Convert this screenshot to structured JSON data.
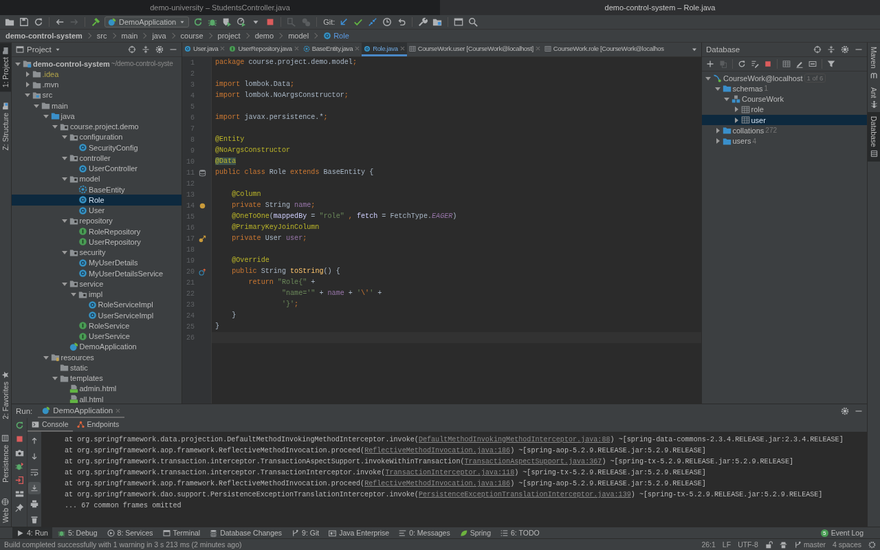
{
  "window_tabs": [
    {
      "title": "demo-university – StudentsController.java",
      "selected": false
    },
    {
      "title": "demo-control-system – Role.java",
      "selected": true
    }
  ],
  "toolbar": [
    {
      "kind": "open",
      "disabled": false
    },
    {
      "kind": "save",
      "disabled": false
    },
    {
      "kind": "sync",
      "disabled": false
    },
    {
      "kind": "sep"
    },
    {
      "kind": "back",
      "disabled": false
    },
    {
      "kind": "forward",
      "disabled": true
    },
    {
      "kind": "sep"
    },
    {
      "kind": "hammer",
      "disabled": false
    },
    {
      "kind": "config",
      "label": "DemoApplication"
    },
    {
      "kind": "rerun",
      "disabled": false
    },
    {
      "kind": "bug",
      "disabled": false
    },
    {
      "kind": "coverage",
      "disabled": false
    },
    {
      "kind": "profile",
      "disabled": false
    },
    {
      "kind": "caret",
      "disabled": false
    },
    {
      "kind": "stop",
      "disabled": false
    },
    {
      "kind": "sep"
    },
    {
      "kind": "attach",
      "disabled": true
    },
    {
      "kind": "threads",
      "disabled": true
    },
    {
      "kind": "sep"
    },
    {
      "kind": "label",
      "text": "Git:"
    },
    {
      "kind": "gitupdate",
      "disabled": false
    },
    {
      "kind": "check",
      "disabled": false
    },
    {
      "kind": "merge",
      "disabled": false
    },
    {
      "kind": "history",
      "disabled": false
    },
    {
      "kind": "revert",
      "disabled": false
    },
    {
      "kind": "sep"
    },
    {
      "kind": "wrench",
      "disabled": false
    },
    {
      "kind": "structure",
      "disabled": false
    },
    {
      "kind": "sep"
    },
    {
      "kind": "terminal",
      "disabled": false
    },
    {
      "kind": "search",
      "disabled": false
    }
  ],
  "breadcrumb": [
    {
      "label": "demo-control-system",
      "kind": "root"
    },
    {
      "label": "src",
      "kind": "plain"
    },
    {
      "label": "main",
      "kind": "plain"
    },
    {
      "label": "java",
      "kind": "plain"
    },
    {
      "label": "course",
      "kind": "plain"
    },
    {
      "label": "project",
      "kind": "plain"
    },
    {
      "label": "demo",
      "kind": "plain"
    },
    {
      "label": "model",
      "kind": "plain"
    },
    {
      "label": "Role",
      "kind": "class"
    }
  ],
  "left_stripe": {
    "top": [
      {
        "label": "1: Project",
        "kind": "folder",
        "selected": true
      },
      {
        "label": "Z: Structure",
        "kind": "structure",
        "selected": false
      }
    ],
    "bottom": [
      {
        "label": "2: Favorites",
        "kind": "star",
        "selected": false
      },
      {
        "label": "Persistence",
        "kind": "persistence",
        "selected": false
      },
      {
        "label": "Web",
        "kind": "web",
        "selected": false
      }
    ]
  },
  "right_stripe": [
    {
      "label": "Maven",
      "kind": "maven",
      "selected": false
    },
    {
      "label": "Ant",
      "kind": "ant",
      "selected": false
    },
    {
      "label": "Database",
      "kind": "database",
      "selected": true
    }
  ],
  "project": {
    "title": "Project",
    "tree": [
      {
        "label": "demo-control-system",
        "hint": "~/demo-control-syste",
        "kind": "module",
        "expanded": true,
        "selected": false,
        "ignored": false,
        "children": [
          {
            "label": ".idea",
            "kind": "folder",
            "expanded": false,
            "selected": false,
            "ignored": true
          },
          {
            "label": ".mvn",
            "kind": "folder",
            "expanded": false,
            "selected": false,
            "ignored": false
          },
          {
            "label": "src",
            "kind": "src",
            "expanded": true,
            "selected": false,
            "ignored": false,
            "children": [
              {
                "label": "main",
                "kind": "folder",
                "expanded": true,
                "selected": false,
                "ignored": false,
                "children": [
                  {
                    "label": "java",
                    "kind": "folder-blue",
                    "expanded": true,
                    "selected": false,
                    "ignored": false,
                    "children": [
                      {
                        "label": "course.project.demo",
                        "kind": "package",
                        "expanded": true,
                        "selected": false,
                        "ignored": false,
                        "children": [
                          {
                            "label": "configuration",
                            "kind": "package",
                            "expanded": true,
                            "selected": false,
                            "ignored": false,
                            "children": [
                              {
                                "label": "SecurityConfig",
                                "kind": "class",
                                "selected": false,
                                "ignored": false
                              }
                            ]
                          },
                          {
                            "label": "controller",
                            "kind": "package",
                            "expanded": true,
                            "selected": false,
                            "ignored": false,
                            "children": [
                              {
                                "label": "UserController",
                                "kind": "class",
                                "selected": false,
                                "ignored": false
                              }
                            ]
                          },
                          {
                            "label": "model",
                            "kind": "package",
                            "expanded": true,
                            "selected": false,
                            "ignored": false,
                            "children": [
                              {
                                "label": "BaseEntity",
                                "kind": "abstract",
                                "selected": false,
                                "ignored": false
                              },
                              {
                                "label": "Role",
                                "kind": "class",
                                "selected": true,
                                "ignored": false
                              },
                              {
                                "label": "User",
                                "kind": "class",
                                "selected": false,
                                "ignored": false
                              }
                            ]
                          },
                          {
                            "label": "repository",
                            "kind": "package",
                            "expanded": true,
                            "selected": false,
                            "ignored": false,
                            "children": [
                              {
                                "label": "RoleRepository",
                                "kind": "interface",
                                "selected": false,
                                "ignored": false
                              },
                              {
                                "label": "UserRepository",
                                "kind": "interface",
                                "selected": false,
                                "ignored": false
                              }
                            ]
                          },
                          {
                            "label": "security",
                            "kind": "package",
                            "expanded": true,
                            "selected": false,
                            "ignored": false,
                            "children": [
                              {
                                "label": "MyUserDetails",
                                "kind": "class",
                                "selected": false,
                                "ignored": false
                              },
                              {
                                "label": "MyUserDetailsService",
                                "kind": "class",
                                "selected": false,
                                "ignored": false
                              }
                            ]
                          },
                          {
                            "label": "service",
                            "kind": "package",
                            "expanded": true,
                            "selected": false,
                            "ignored": false,
                            "children": [
                              {
                                "label": "impl",
                                "kind": "package",
                                "expanded": true,
                                "selected": false,
                                "ignored": false,
                                "children": [
                                  {
                                    "label": "RoleServiceImpl",
                                    "kind": "class",
                                    "selected": false,
                                    "ignored": false
                                  },
                                  {
                                    "label": "UserServiceImpl",
                                    "kind": "class",
                                    "selected": false,
                                    "ignored": false
                                  }
                                ]
                              },
                              {
                                "label": "RoleService",
                                "kind": "interface",
                                "selected": false,
                                "ignored": false
                              },
                              {
                                "label": "UserService",
                                "kind": "interface",
                                "selected": false,
                                "ignored": false
                              }
                            ]
                          },
                          {
                            "label": "DemoApplication",
                            "kind": "spring",
                            "selected": false,
                            "ignored": false
                          }
                        ]
                      }
                    ]
                  },
                  {
                    "label": "resources",
                    "kind": "resources",
                    "expanded": true,
                    "selected": false,
                    "ignored": false,
                    "children": [
                      {
                        "label": "static",
                        "kind": "folder",
                        "selected": false,
                        "ignored": false
                      },
                      {
                        "label": "templates",
                        "kind": "folder",
                        "expanded": true,
                        "selected": false,
                        "ignored": false,
                        "children": [
                          {
                            "label": "admin.html",
                            "kind": "html",
                            "selected": false,
                            "ignored": false
                          },
                          {
                            "label": "all.html",
                            "kind": "html",
                            "selected": false,
                            "ignored": false
                          }
                        ]
                      }
                    ]
                  }
                ]
              }
            ]
          }
        ]
      }
    ]
  },
  "editor": {
    "tabs": [
      {
        "label": "User.java",
        "kind": "class",
        "selected": false,
        "closable": true
      },
      {
        "label": "UserRepository.java",
        "kind": "interface",
        "selected": false,
        "closable": true
      },
      {
        "label": "BaseEntity.java",
        "kind": "abstract",
        "selected": false,
        "closable": true
      },
      {
        "label": "Role.java",
        "kind": "class",
        "selected": true,
        "closable": true
      },
      {
        "label": "CourseWork.user [CourseWork@localhost]",
        "kind": "table",
        "selected": false,
        "closable": true
      },
      {
        "label": "CourseWork.role [CourseWork@localhos",
        "kind": "table",
        "selected": false,
        "closable": false
      }
    ],
    "lines": [
      {
        "n": "1",
        "current": false,
        "tokens": [
          {
            "text": "package",
            "kind": "kw"
          },
          {
            "text": " course.project.demo.model"
          },
          {
            "text": ";",
            "kind": "kw"
          }
        ]
      },
      {
        "n": "2",
        "current": false
      },
      {
        "n": "3",
        "current": false,
        "tokens": [
          {
            "text": "import",
            "kind": "kw"
          },
          {
            "text": " lombok.Data"
          },
          {
            "text": ";",
            "kind": "kw"
          }
        ]
      },
      {
        "n": "4",
        "current": false,
        "tokens": [
          {
            "text": "import",
            "kind": "kw"
          },
          {
            "text": " lombok.NoArgsConstructor"
          },
          {
            "text": ";",
            "kind": "kw"
          }
        ]
      },
      {
        "n": "5",
        "current": false
      },
      {
        "n": "6",
        "current": false,
        "tokens": [
          {
            "text": "import",
            "kind": "kw"
          },
          {
            "text": " javax.persistence.*"
          },
          {
            "text": ";",
            "kind": "kw"
          }
        ]
      },
      {
        "n": "7",
        "current": false
      },
      {
        "n": "8",
        "current": false,
        "tokens": [
          {
            "text": "@Entity",
            "kind": "ann"
          }
        ]
      },
      {
        "n": "9",
        "current": false,
        "tokens": [
          {
            "text": "@NoArgsConstructor",
            "kind": "ann"
          }
        ]
      },
      {
        "n": "10",
        "current": false,
        "tokens": [
          {
            "text": "@Data",
            "kind": "annhl"
          }
        ]
      },
      {
        "n": "11",
        "current": false,
        "tokens": [
          {
            "text": "public class ",
            "kind": "kw"
          },
          {
            "text": "Role "
          },
          {
            "text": "extends ",
            "kind": "kw"
          },
          {
            "text": "BaseEntity {"
          }
        ]
      },
      {
        "n": "12",
        "current": false
      },
      {
        "n": "13",
        "current": false,
        "tokens": [
          {
            "text": "    @Column",
            "kind": "ann"
          }
        ]
      },
      {
        "n": "14",
        "current": false,
        "tokens": [
          {
            "text": "    private ",
            "kind": "kw"
          },
          {
            "text": "String "
          },
          {
            "text": "name",
            "kind": "field"
          },
          {
            "text": ";",
            "kind": "kw"
          }
        ]
      },
      {
        "n": "15",
        "current": false,
        "tokens": [
          {
            "text": "    @OneToOne",
            "kind": "ann"
          },
          {
            "text": "("
          },
          {
            "text": "mappedBy",
            "kind": "param"
          },
          {
            "text": " = "
          },
          {
            "text": "\"role\"",
            "kind": "str"
          },
          {
            "text": " ,",
            "kind": "kw"
          },
          {
            "text": " fetch",
            "kind": "param"
          },
          {
            "text": " = FetchType."
          },
          {
            "text": "EAGER",
            "kind": "const"
          },
          {
            "text": ")"
          }
        ]
      },
      {
        "n": "16",
        "current": false,
        "tokens": [
          {
            "text": "    @PrimaryKeyJoinColumn",
            "kind": "ann"
          }
        ]
      },
      {
        "n": "17",
        "current": false,
        "tokens": [
          {
            "text": "    private ",
            "kind": "kw"
          },
          {
            "text": "User "
          },
          {
            "text": "user",
            "kind": "field"
          },
          {
            "text": ";",
            "kind": "kw"
          }
        ]
      },
      {
        "n": "18",
        "current": false
      },
      {
        "n": "19",
        "current": false,
        "tokens": [
          {
            "text": "    @Override",
            "kind": "ann"
          }
        ]
      },
      {
        "n": "20",
        "current": false,
        "tokens": [
          {
            "text": "    public ",
            "kind": "kw"
          },
          {
            "text": "String "
          },
          {
            "text": "toString",
            "kind": "method"
          },
          {
            "text": "() {"
          }
        ]
      },
      {
        "n": "21",
        "current": false,
        "tokens": [
          {
            "text": "        return ",
            "kind": "kw"
          },
          {
            "text": "\"Role{\"",
            "kind": "str"
          },
          {
            "text": " +"
          }
        ]
      },
      {
        "n": "22",
        "current": false,
        "tokens": [
          {
            "text": "                \"name='\"",
            "kind": "str"
          },
          {
            "text": " + "
          },
          {
            "text": "name",
            "kind": "field"
          },
          {
            "text": " + "
          },
          {
            "text": "'",
            "kind": "str"
          },
          {
            "text": "\\'",
            "kind": "kw"
          },
          {
            "text": "'",
            "kind": "str"
          },
          {
            "text": " +"
          }
        ]
      },
      {
        "n": "23",
        "current": false,
        "tokens": [
          {
            "text": "                '}'",
            "kind": "str"
          },
          {
            "text": ";",
            "kind": "kw"
          }
        ]
      },
      {
        "n": "24",
        "current": false,
        "tokens": [
          {
            "text": "    }"
          }
        ]
      },
      {
        "n": "25",
        "current": false,
        "tokens": [
          {
            "text": "}"
          }
        ]
      },
      {
        "n": "26",
        "current": true
      }
    ]
  },
  "database": {
    "title": "Database",
    "toolbar": [
      {
        "kind": "plus",
        "disabled": false
      },
      {
        "kind": "copy",
        "disabled": true
      },
      {
        "kind": "sync",
        "disabled": false
      },
      {
        "kind": "props",
        "disabled": false
      },
      {
        "kind": "stop",
        "disabled": false
      },
      {
        "kind": "table",
        "disabled": false
      },
      {
        "kind": "pencil",
        "disabled": false
      },
      {
        "kind": "ddl",
        "disabled": false
      },
      {
        "kind": "filter",
        "disabled": false
      }
    ],
    "tree": [
      {
        "label": "CourseWork@localhost",
        "badge": "1 of 6",
        "kind": "datasource",
        "expanded": true,
        "selected": false,
        "children": [
          {
            "label": "schemas",
            "count": "1",
            "kind": "folder-blue",
            "expanded": true,
            "selected": false,
            "children": [
              {
                "label": "CourseWork",
                "kind": "schema",
                "expanded": true,
                "selected": false,
                "children": [
                  {
                    "label": "role",
                    "kind": "table",
                    "expanded": false,
                    "selected": false
                  },
                  {
                    "label": "user",
                    "kind": "table",
                    "expanded": false,
                    "selected": true
                  }
                ]
              }
            ]
          },
          {
            "label": "collations",
            "count": "272",
            "kind": "folder-blue",
            "expanded": false,
            "selected": false
          },
          {
            "label": "users",
            "count": "4",
            "kind": "folder-blue",
            "expanded": false,
            "selected": false
          }
        ]
      }
    ]
  },
  "run_panel": {
    "label": "Run:",
    "tabs": [
      {
        "label": "DemoApplication",
        "selected": true
      }
    ],
    "subtabs": [
      {
        "label": "Console",
        "kind": "console",
        "selected": true
      },
      {
        "label": "Endpoints",
        "kind": "endpoints",
        "selected": false
      }
    ],
    "console_tools": [
      {
        "kind": "up",
        "on": false
      },
      {
        "kind": "down",
        "on": false
      },
      {
        "kind": "wrap",
        "on": false
      },
      {
        "kind": "scrollend",
        "on": true
      },
      {
        "kind": "print",
        "on": false
      },
      {
        "kind": "trash",
        "on": false
      }
    ],
    "console": [
      {
        "text": "at org.springframework.data.projection.DefaultMethodInvokingMethodInterceptor.invoke(",
        "link": "DefaultMethodInvokingMethodInterceptor.java:88",
        "tail": ") ~[spring-data-commons-2.3.4.RELEASE.jar:2.3.4.RELEASE]"
      },
      {
        "text": "at org.springframework.aop.framework.ReflectiveMethodInvocation.proceed(",
        "link": "ReflectiveMethodInvocation.java:186",
        "tail": ") ~[spring-aop-5.2.9.RELEASE.jar:5.2.9.RELEASE]"
      },
      {
        "text": "at org.springframework.transaction.interceptor.TransactionAspectSupport.invokeWithinTransaction(",
        "link": "TransactionAspectSupport.java:367",
        "tail": ") ~[spring-tx-5.2.9.RELEASE.jar:5.2.9.RELEASE]"
      },
      {
        "text": "at org.springframework.transaction.interceptor.TransactionInterceptor.invoke(",
        "link": "TransactionInterceptor.java:118",
        "tail": ") ~[spring-tx-5.2.9.RELEASE.jar:5.2.9.RELEASE]"
      },
      {
        "text": "at org.springframework.aop.framework.ReflectiveMethodInvocation.proceed(",
        "link": "ReflectiveMethodInvocation.java:186",
        "tail": ") ~[spring-aop-5.2.9.RELEASE.jar:5.2.9.RELEASE]"
      },
      {
        "text": "at org.springframework.dao.support.PersistenceExceptionTranslationInterceptor.invoke(",
        "link": "PersistenceExceptionTranslationInterceptor.java:139",
        "tail": ") ~[spring-tx-5.2.9.RELEASE.jar:5.2.9.RELEASE]"
      },
      {
        "text": "... 67 common frames omitted"
      }
    ]
  },
  "tool_windows": [
    {
      "label": "4: Run",
      "kind": "run",
      "selected": true
    },
    {
      "label": "5: Debug",
      "kind": "bug",
      "selected": false
    },
    {
      "label": "8: Services",
      "kind": "services",
      "selected": false
    },
    {
      "label": "Terminal",
      "kind": "terminal",
      "selected": false
    },
    {
      "label": "Database Changes",
      "kind": "dbchanges",
      "selected": false
    },
    {
      "label": "9: Git",
      "kind": "branch",
      "selected": false
    },
    {
      "label": "Java Enterprise",
      "kind": "javaee",
      "selected": false
    },
    {
      "label": "0: Messages",
      "kind": "messages",
      "selected": false
    },
    {
      "label": "Spring",
      "kind": "spring-leaf",
      "selected": false
    },
    {
      "label": "6: TODO",
      "kind": "todo",
      "selected": false
    }
  ],
  "event_log": {
    "label": "Event Log",
    "badge": "5"
  },
  "status_bar": {
    "message": "Build completed successfully with 1 warning in 3 s 213 ms (2 minutes ago)",
    "position": "26:1",
    "line_separator": "LF",
    "encoding": "UTF-8",
    "branch": "master",
    "indent": "4 spaces"
  }
}
